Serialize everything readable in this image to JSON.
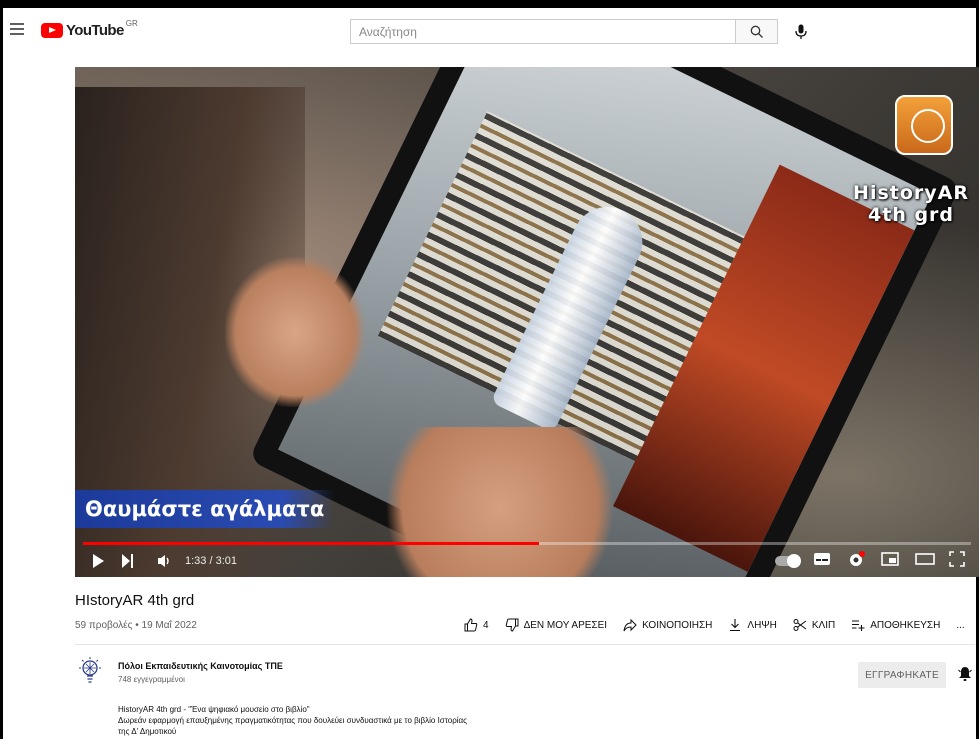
{
  "header": {
    "logo_text": "YouTube",
    "logo_region": "GR",
    "search_placeholder": "Αναζήτηση"
  },
  "video": {
    "caption": "Θαυμάστε αγάλματα",
    "brand_overlay_line1": "HistoryAR",
    "brand_overlay_line2": "4th grd",
    "time_current": "1:33",
    "time_total": "3:01",
    "time_display": "1:33 / 3:01",
    "progress": 0.514
  },
  "info": {
    "title": "HIstoryAR 4th grd",
    "meta": "59 προβολές • 19 Μαΐ 2022"
  },
  "actions": {
    "likes": "4",
    "dislike": "ΔΕΝ ΜΟΥ ΑΡΕΣΕΙ",
    "share": "ΚΟΙΝΟΠΟΙΗΣΗ",
    "download": "ΛΗΨΗ",
    "clip": "ΚΛΙΠ",
    "save": "ΑΠΟΘΗΚΕΥΣΗ",
    "more": "..."
  },
  "channel": {
    "name": "Πόλοι Εκπαιδευτικής Καινοτομίας ΤΠΕ",
    "subscribers": "748 εγγεγραμμένοι",
    "subscribe_label": "ΕΓΓΡΑΦΗΚΑΤΕ"
  },
  "description": {
    "line1": "HistoryAR 4th grd - \"Ένα ψηφιακό μουσείο στο βιβλίο\"",
    "line2": "Δωρεάν εφαρμογή επαυξημένης πραγματικότητας που δουλεύει συνδυαστικά με το βιβλίο Ιστορίας",
    "line3": "της Δ' Δημοτικού"
  },
  "colors": {
    "accent": "#ff0000",
    "caption_bg": "#1c3a9a",
    "logo_orange": "#f3a13a"
  }
}
